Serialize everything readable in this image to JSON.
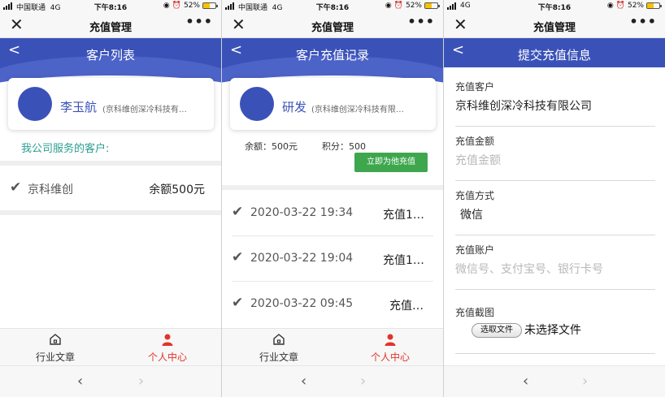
{
  "status_bar": {
    "carrier": "中国联通",
    "network": "4G",
    "time": "下午8:16",
    "battery": "52%"
  },
  "wechat_bar": {
    "title": "充值管理",
    "close": "✕",
    "more": "•••"
  },
  "nav": {
    "back": "‹",
    "forward": "›"
  },
  "tabs": {
    "articles": "行业文章",
    "profile": "个人中心"
  },
  "colors": {
    "primary": "#3a52b8",
    "accent_red": "#e0352b",
    "green_button": "#3ea74e",
    "teal_text": "#2a9d8f"
  },
  "customer_list": {
    "header_title": "客户列表",
    "user_name": "李玉航",
    "user_company": "(京科维创深冷科技有…",
    "section_title": "我公司服务的客户:",
    "customers": [
      {
        "name": "京科维创",
        "balance": "余额500元"
      }
    ]
  },
  "recharge_records": {
    "header_title": "客户充值记录",
    "customer_name": "研发",
    "customer_company": "(京科维创深冷科技有限…",
    "balance": "余额：500元",
    "points": "积分：500",
    "recharge_button": "立即为他充值",
    "records": [
      {
        "datetime": "2020-03-22 19:34",
        "status": "充值1…"
      },
      {
        "datetime": "2020-03-22 19:04",
        "status": "充值1…"
      },
      {
        "datetime": "2020-03-22 09:45",
        "status": "充值…"
      }
    ]
  },
  "submit_form": {
    "header_title": "提交充值信息",
    "customer_label": "充值客户",
    "customer_value": "京科维创深冷科技有限公司",
    "amount_label": "充值金额",
    "amount_placeholder": "充值金额",
    "method_label": "充值方式",
    "method_value": "微信",
    "account_label": "充值账户",
    "account_placeholder": "微信号、支付宝号、银行卡号",
    "screenshot_label": "充值截图",
    "file_button": "选取文件",
    "file_status": "未选择文件"
  }
}
